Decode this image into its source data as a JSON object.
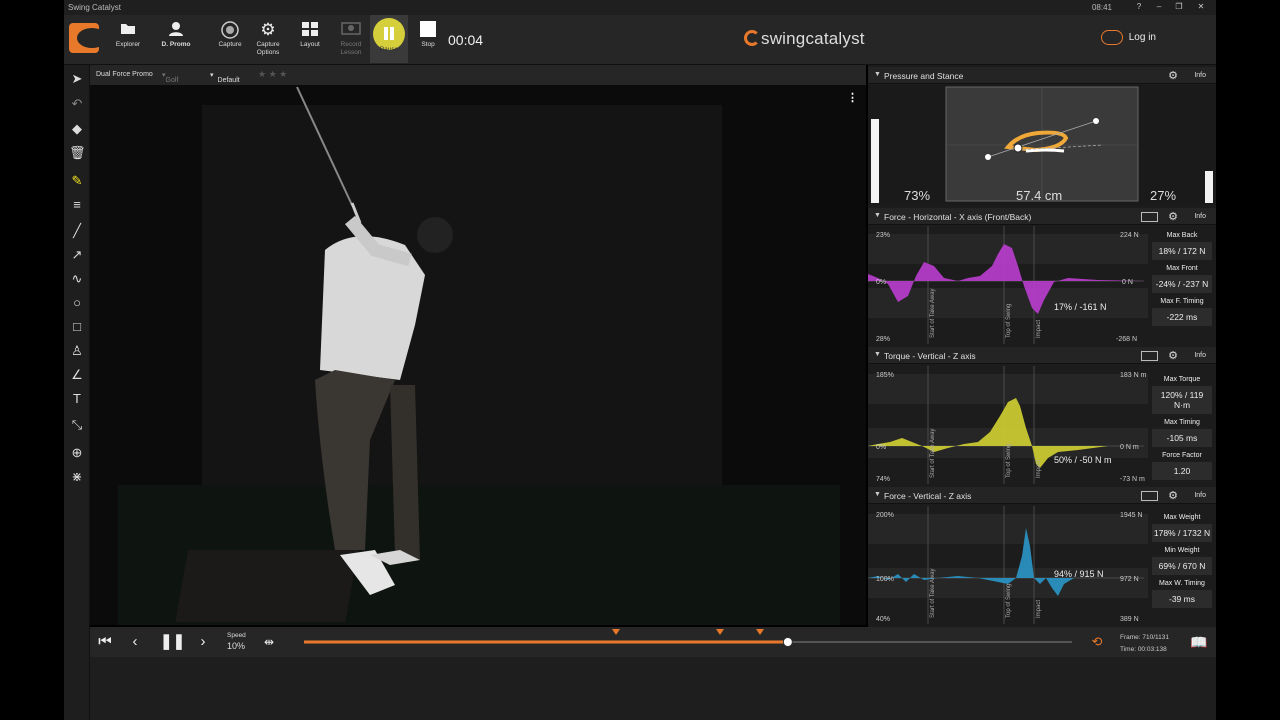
{
  "window": {
    "title": "Swing Catalyst",
    "clock": "08:41",
    "controls": [
      "?",
      "–",
      "❐",
      "✕"
    ]
  },
  "toolbar": {
    "explorer": "Explorer",
    "promo": "D. Promo",
    "capture": "Capture",
    "capture_options": "Capture Options",
    "layout": "Layout",
    "record_lesson": "Record Lesson",
    "pause": "Pause",
    "stop": "Stop",
    "timer": "00:04",
    "brand": "swingcatalyst",
    "login": "Log in"
  },
  "video_header": {
    "plate": "Dual Force Promo",
    "sport": "Golf",
    "preset": "Default",
    "rating": "★ ★ ★"
  },
  "panels": {
    "pressure": {
      "title": "Pressure and Stance",
      "info": "Info",
      "left_pct": "73%",
      "right_pct": "27%",
      "stance": "57.4 cm"
    },
    "force_h": {
      "title": "Force - Horizontal - X axis (Front/Back)",
      "info": "Info",
      "y_top_left": "23%",
      "y_zero_left": "0%",
      "y_bottom_left": "28%",
      "y_top_right": "224 N",
      "y_zero_right": "0 N",
      "y_bottom_right": "-268 N",
      "cursor_label": "17% / -161 N",
      "stats": [
        {
          "label": "Max Back",
          "value": "18% / 172 N"
        },
        {
          "label": "Max Front",
          "value": "-24% / -237 N"
        },
        {
          "label": "Max F. Timing",
          "value": "-222 ms"
        }
      ]
    },
    "torque": {
      "title": "Torque - Vertical - Z axis",
      "info": "Info",
      "y_top_left": "185%",
      "y_zero_left": "0%",
      "y_bottom_left": "74%",
      "y_top_right": "183 N m",
      "y_zero_right": "0 N m",
      "y_bottom_right": "-73 N m",
      "cursor_label": "50% / -50 N m",
      "stats": [
        {
          "label": "Max Torque",
          "value": "120% / 119 N·m"
        },
        {
          "label": "Max Timing",
          "value": "-105 ms"
        },
        {
          "label": "Force Factor",
          "value": "1.20"
        }
      ]
    },
    "force_v": {
      "title": "Force - Vertical - Z axis",
      "info": "Info",
      "y_top_left": "200%",
      "y_mid_left": "100%",
      "y_bottom_left": "40%",
      "y_top_right": "1945 N",
      "y_mid_right": "972 N",
      "y_bottom_right": "389 N",
      "cursor_label": "94% / 915 N",
      "stats": [
        {
          "label": "Max Weight",
          "value": "178% / 1732 N"
        },
        {
          "label": "Min Weight",
          "value": "69% / 670 N"
        },
        {
          "label": "Max W. Timing",
          "value": "-39 ms"
        }
      ]
    },
    "markers": {
      "takeaway": "Start of Take Away",
      "top": "Top of Swing",
      "impact": "Impact"
    }
  },
  "playback": {
    "speed_label": "Speed",
    "speed_value": "10%",
    "frame": "Frame: 710/1131",
    "time": "Time: 00:03:138",
    "progress": 0.63
  },
  "colors": {
    "accent": "#e8792a",
    "force_h": "#b43cc8",
    "torque": "#c8c832",
    "force_v": "#2a90c0"
  }
}
